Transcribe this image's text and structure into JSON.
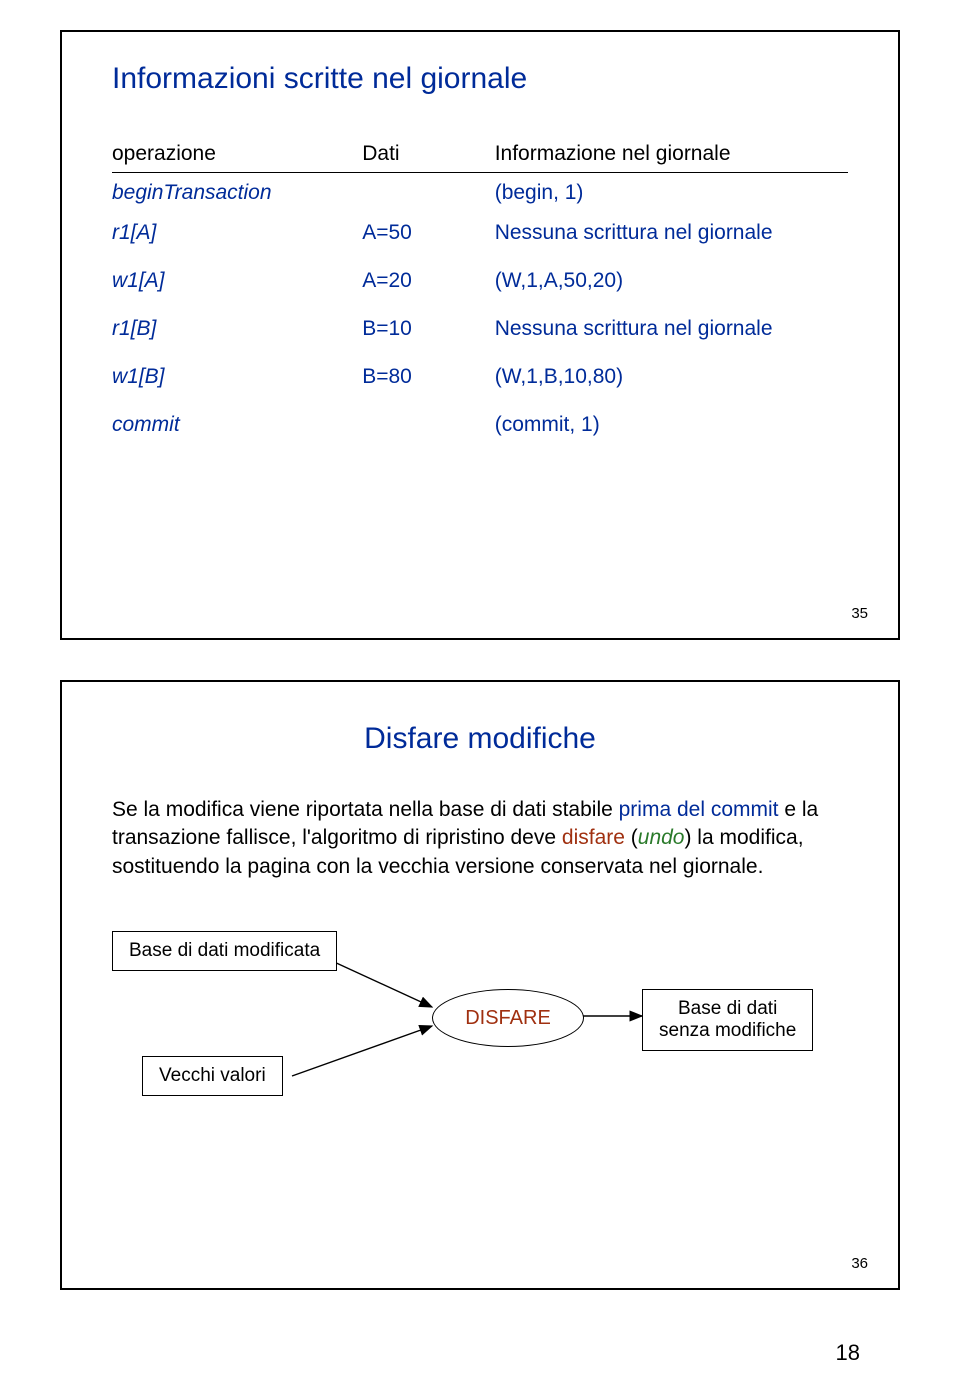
{
  "slide1": {
    "title": "Informazioni scritte nel giornale",
    "headers": {
      "op": "operazione",
      "dati": "Dati",
      "info": "Informazione nel giornale"
    },
    "rows": [
      {
        "op": "beginTransaction",
        "dati": "",
        "info": "(begin, 1)"
      },
      {
        "op": "r1[A]",
        "dati": "A=50",
        "info": "Nessuna scrittura nel giornale"
      },
      {
        "op": "w1[A]",
        "dati": "A=20",
        "info": "(W,1,A,50,20)"
      },
      {
        "op": "r1[B]",
        "dati": "B=10",
        "info": "Nessuna scrittura nel giornale"
      },
      {
        "op": "w1[B]",
        "dati": "B=80",
        "info": "(W,1,B,10,80)"
      },
      {
        "op": "commit",
        "dati": "",
        "info": "(commit, 1)"
      }
    ],
    "num": "35"
  },
  "slide2": {
    "title": "Disfare modifiche",
    "para_pre": "Se la modifica viene riportata nella base di dati stabile ",
    "blue1": "prima del commit ",
    "mid1": "e la transazione fallisce, l'algoritmo di ripristino deve ",
    "red1": "disfare ",
    "mid2": "(",
    "green1": "undo",
    "mid3": ") la modifica, sostituendo la pagina con la vecchia versione conservata nel giornale.",
    "box_modificata": "Base di dati modificata",
    "box_vecchi": "Vecchi valori",
    "oval": "DISFARE",
    "box_senza_l1": "Base di dati",
    "box_senza_l2": "senza modifiche",
    "num": "36"
  },
  "page_number": "18"
}
